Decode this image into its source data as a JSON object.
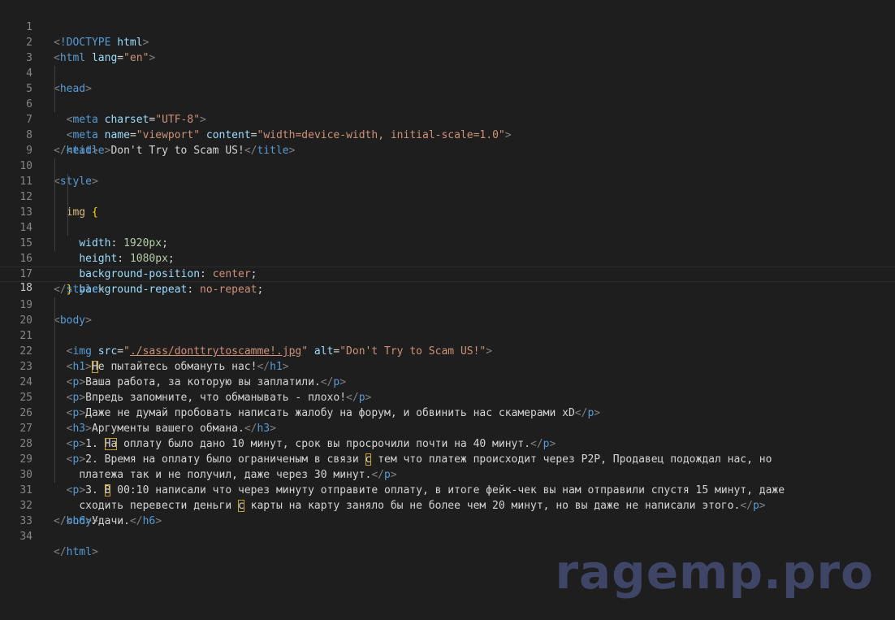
{
  "editor": {
    "language": "html",
    "active_line": 18,
    "colors": {
      "background": "#1e1e1e",
      "line_number": "#858585",
      "tag": "#569cd6",
      "punctuation": "#808080",
      "attribute": "#9cdcfe",
      "string": "#ce9178",
      "number": "#b5cea8",
      "selector": "#d7ba7d",
      "text": "#d4d4d4"
    },
    "lines": [
      {
        "num": "1"
      },
      {
        "num": "2"
      },
      {
        "num": "3"
      },
      {
        "num": "4"
      },
      {
        "num": "5"
      },
      {
        "num": "6"
      },
      {
        "num": "7"
      },
      {
        "num": "8"
      },
      {
        "num": "9"
      },
      {
        "num": "10"
      },
      {
        "num": "11"
      },
      {
        "num": "12"
      },
      {
        "num": "13"
      },
      {
        "num": "14"
      },
      {
        "num": "15"
      },
      {
        "num": "16"
      },
      {
        "num": "17"
      },
      {
        "num": "18"
      },
      {
        "num": "19"
      },
      {
        "num": "20"
      },
      {
        "num": "21"
      },
      {
        "num": "22"
      },
      {
        "num": "23"
      },
      {
        "num": "24"
      },
      {
        "num": "25"
      },
      {
        "num": "26"
      },
      {
        "num": "27"
      },
      {
        "num": "28"
      },
      {
        "num": "29"
      },
      {
        "num": "30"
      },
      {
        "num": "31"
      },
      {
        "num": "32"
      },
      {
        "num": "33"
      },
      {
        "num": "34"
      }
    ]
  },
  "code": {
    "doctype_kw": "!DOCTYPE",
    "doctype_val": "html",
    "html": "html",
    "lang_attr": "lang",
    "lang_val": "\"en\"",
    "head": "head",
    "meta": "meta",
    "charset_attr": "charset",
    "charset_val": "\"UTF-8\"",
    "name_attr": "name",
    "name_val": "\"viewport\"",
    "content_attr": "content",
    "content_val": "\"width=device-width, initial-scale=1.0\"",
    "title": "title",
    "title_text": "Don't Try to Scam US!",
    "style": "style",
    "css_selector": "img",
    "css_width_prop": "width",
    "css_width_val": "1920px",
    "css_height_prop": "height",
    "css_height_val": "1080px",
    "css_bgpos_prop": "background-position",
    "css_bgpos_val": "center",
    "css_bgrep_prop": "background-repeat",
    "css_bgrep_val": "no-repeat",
    "body": "body",
    "img": "img",
    "src_attr": "src",
    "src_val": "./sass/donttrytoscamme!.jpg",
    "alt_attr": "alt",
    "alt_val": "\"Don't Try to Scam US!\"",
    "h1": "h1",
    "h1_first": "Н",
    "h1_rest": "е пытайтесь обмануть нас!",
    "p": "p",
    "p1_text": "Ваша работа, за которую вы заплатили.",
    "p2_text": "Впредь запомните, что обманывать - плохо!",
    "p3_text": "Даже не думай пробовать написать жалобу на форум, и обвинить нас скамерами xD",
    "h3": "h3",
    "h3_text": "Аргументы вашего обмана.",
    "p4_pre": "1. ",
    "p4_hl": "На",
    "p4_rest": " оплату было дано 10 минут, срок вы просрочили почти на 40 минут.",
    "p5_pre": "2. Время на оплату было ограниченым в связи ",
    "p5_hl": "с",
    "p5_rest": " тем что платеж происходит через P2P, Продавец подождал нас, но",
    "p5_line2": "платежа так и не получил, даже через 30 минут.",
    "p6_pre": "3. ",
    "p6_hl": "В",
    "p6_rest": " 00:10 написали что через минуту отправите оплату, в итоге фейк-чек вы нам отправили спустя 15 минут, даже",
    "p6_line2_pre": "сходить перевести деньги ",
    "p6_line2_hl": "с",
    "p6_line2_rest": " карты на карту заняло бы не более чем 20 минут, но вы даже не написали этого.",
    "h6": "h6",
    "h6_text": "Удачи."
  },
  "watermark": {
    "text": "ragemp.pro"
  }
}
